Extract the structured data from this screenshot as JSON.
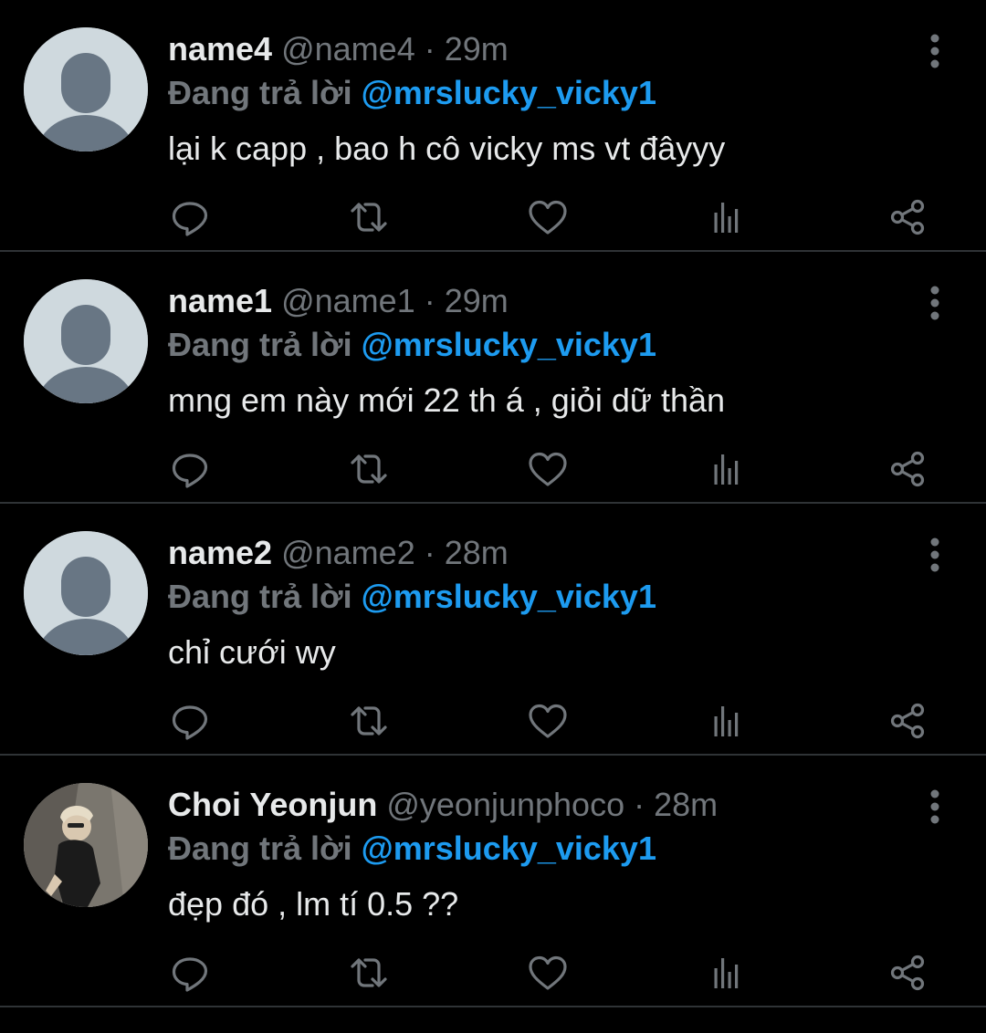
{
  "colors": {
    "background": "#000000",
    "primary_text": "#e7e9ea",
    "secondary_text": "#71767b",
    "mention": "#1d9bf0",
    "divider": "#2f3336",
    "avatar_placeholder": "#cfd9de",
    "avatar_figure": "#687684"
  },
  "tweets": [
    {
      "name": "name4",
      "handle": "@name4",
      "separator": "·",
      "time": "29m",
      "replying_label": "Đang trả lời",
      "replying_to": "@mrslucky_vicky1",
      "text": "lại k capp , bao h cô vicky ms vt đâyyy",
      "avatar": "default-avatar"
    },
    {
      "name": "name1",
      "handle": "@name1",
      "separator": "·",
      "time": "29m",
      "replying_label": "Đang trả lời",
      "replying_to": "@mrslucky_vicky1",
      "text": "mng em này mới 22 th á , giỏi dữ thần",
      "avatar": "default-avatar"
    },
    {
      "name": "name2",
      "handle": "@name2",
      "separator": "·",
      "time": "28m",
      "replying_label": "Đang trả lời",
      "replying_to": "@mrslucky_vicky1",
      "text": "chỉ cưới wy",
      "avatar": "default-avatar"
    },
    {
      "name": "Choi Yeonjun",
      "handle": "@yeonjunphoco",
      "separator": "·",
      "time": "28m",
      "replying_label": "Đang trả lời",
      "replying_to": "@mrslucky_vicky1",
      "text": "đẹp đó , lm tí 0.5 ??",
      "avatar": "photo-avatar"
    }
  ],
  "action_icons": [
    "reply-icon",
    "retweet-icon",
    "like-icon",
    "analytics-icon",
    "share-icon"
  ]
}
